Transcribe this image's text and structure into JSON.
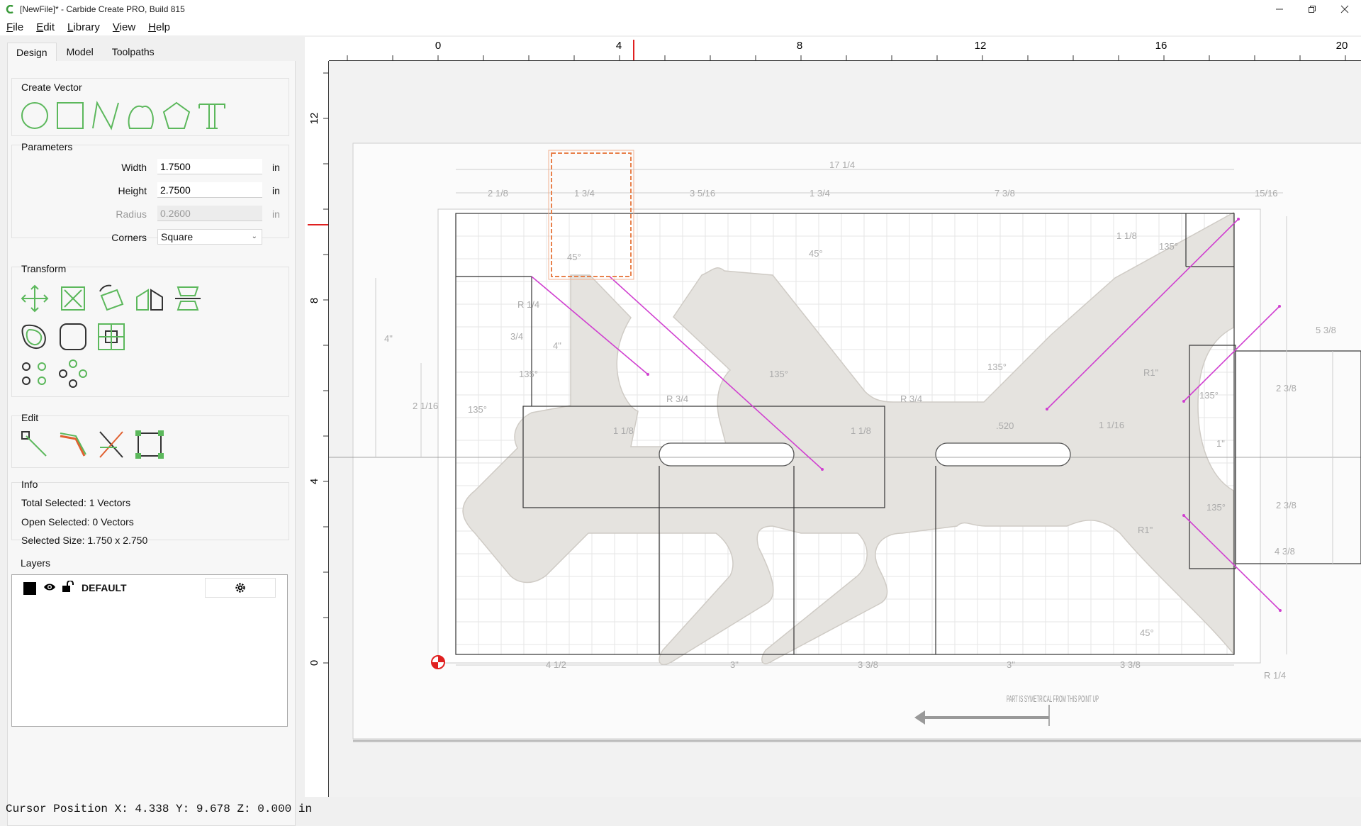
{
  "window": {
    "title": "[NewFile]* - Carbide Create PRO, Build 815"
  },
  "menu": [
    "File",
    "Edit",
    "Library",
    "View",
    "Help"
  ],
  "tabs": [
    "Design",
    "Model",
    "Toolpaths"
  ],
  "create_vector": {
    "title": "Create Vector",
    "icons": [
      "circle-icon",
      "rectangle-icon",
      "polyline-icon",
      "curve-icon",
      "polygon-icon",
      "text-icon"
    ]
  },
  "parameters": {
    "title": "Parameters",
    "width": {
      "label": "Width",
      "value": "1.7500",
      "unit": "in"
    },
    "height": {
      "label": "Height",
      "value": "2.7500",
      "unit": "in"
    },
    "radius": {
      "label": "Radius",
      "value": "0.2600",
      "unit": "in"
    },
    "corners": {
      "label": "Corners",
      "value": "Square"
    }
  },
  "transform": {
    "title": "Transform"
  },
  "edit": {
    "title": "Edit"
  },
  "info": {
    "title": "Info",
    "total_selected": "Total Selected:  1 Vectors",
    "open_selected": "Open Selected:  0 Vectors",
    "selected_size": "Selected Size:  1.750 x 2.750"
  },
  "layers": {
    "title": "Layers",
    "items": [
      {
        "name": "DEFAULT",
        "color": "#000000"
      }
    ]
  },
  "rulers": {
    "top": [
      "0",
      "4",
      "8",
      "12",
      "16",
      "20"
    ],
    "left": [
      "12",
      "8",
      "4",
      "0"
    ]
  },
  "drawing": {
    "dims_top": [
      "2 1/8",
      "1 3/4",
      "3 5/16",
      "1 3/4",
      "7 3/8",
      "15/16"
    ],
    "dim_overall": "17 1/4",
    "dims_bottom": [
      "4 1/2",
      "3\"",
      "3 3/8",
      "3\"",
      "3 3/8"
    ],
    "angles": [
      "45°",
      "135°",
      "135°",
      "135°",
      "135°",
      "135°",
      "45°",
      "45°",
      "135°",
      "135°"
    ],
    "radius_labels": [
      "R 1/4",
      "R 3/4",
      "R 3/4",
      "R1\"",
      "R1\"",
      "R 1/4"
    ],
    "misc_labels": [
      "4\"",
      "2 1/16",
      "3/4",
      "1 1/8",
      "1 1/8",
      "1 1/16",
      ".520",
      "1 1/8",
      "5 3/8",
      "2 3/8",
      "2 3/8",
      "4 3/8",
      "1\"",
      "4\""
    ],
    "note": "PART IS SYMETRICAL FROM THIS POINT UP"
  },
  "status": {
    "cursor": "Cursor Position X: 4.338 Y: 9.678 Z: 0.000 in"
  },
  "colors": {
    "accent": "#5cb85c",
    "selection": "#e8804a",
    "guide": "#d040d0",
    "origin": "#e02020"
  }
}
